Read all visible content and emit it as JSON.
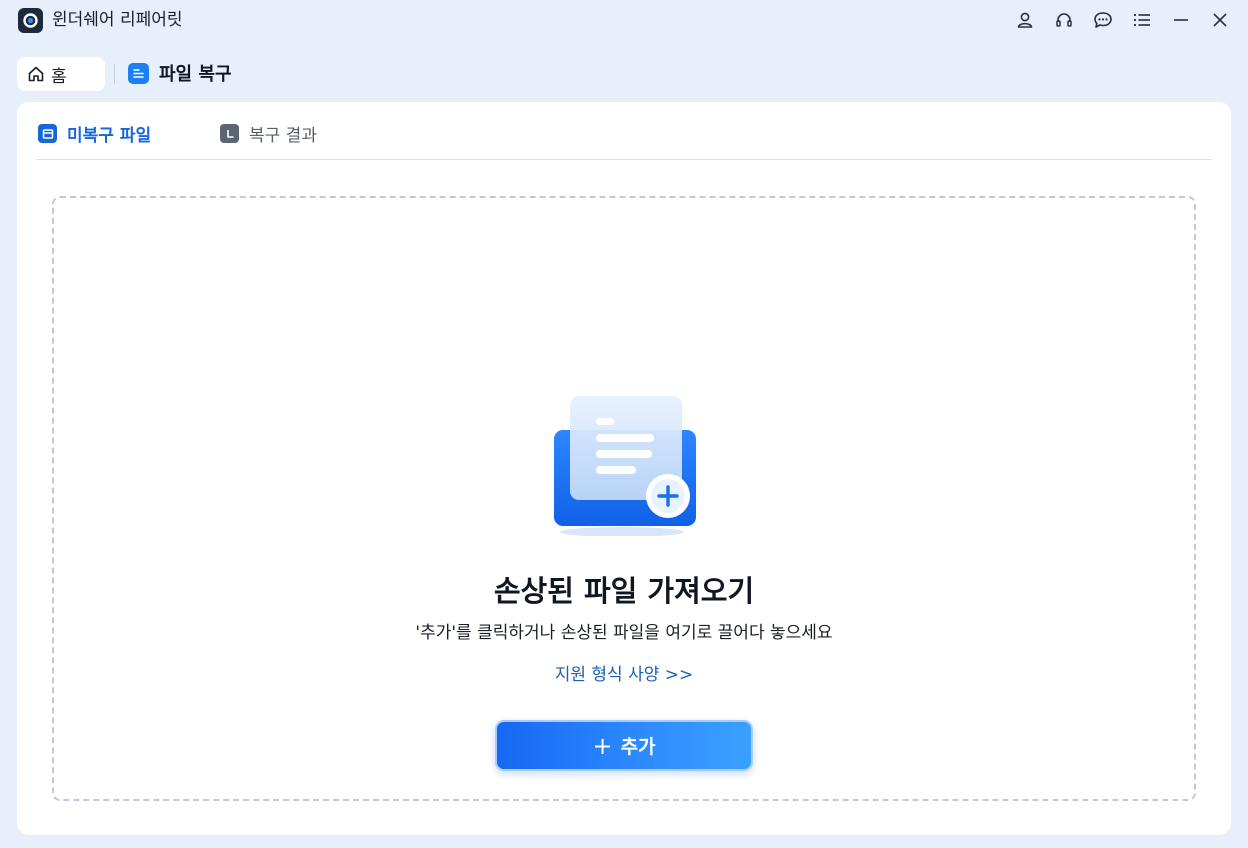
{
  "app": {
    "title": "윈더쉐어 리페어릿"
  },
  "titlebar": {
    "icons": [
      "account-icon",
      "headset-icon",
      "chat-icon",
      "menu-icon",
      "minimize-icon",
      "close-icon"
    ]
  },
  "breadcrumb": {
    "home_label": "홈",
    "current_label": "파일 복구"
  },
  "tabs": [
    {
      "label": "미복구 파일",
      "active": true
    },
    {
      "label": "복구 결과",
      "active": false
    }
  ],
  "dropzone": {
    "title": "손상된 파일 가져오기",
    "subtitle": "'추가'를 클릭하거나 손상된 파일을 여기로 끌어다 놓으세요",
    "link_text": "지원 형식 사양 >>",
    "button_plus": "+",
    "button_label": "추가"
  },
  "colors": {
    "accent": "#1767d6",
    "button_gradient_start": "#1668f2",
    "button_gradient_end": "#3aa1ff",
    "background": "#e7effa"
  }
}
